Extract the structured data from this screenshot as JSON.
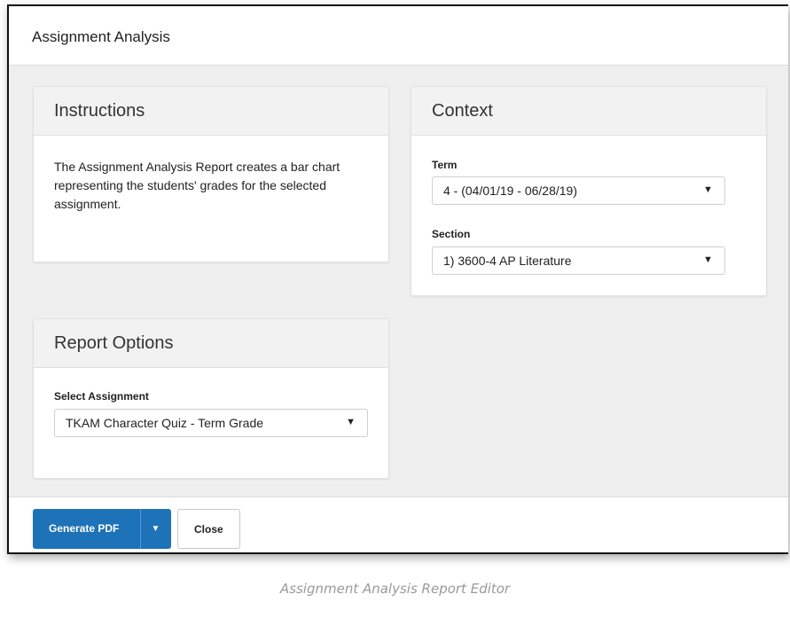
{
  "window": {
    "title": "Assignment Analysis"
  },
  "instructions": {
    "heading": "Instructions",
    "text": "The Assignment Analysis Report creates a bar chart representing the students' grades for the selected assignment."
  },
  "context": {
    "heading": "Context",
    "term": {
      "label": "Term",
      "value": "4 - (04/01/19 - 06/28/19)"
    },
    "section": {
      "label": "Section",
      "value": "1) 3600-4 AP Literature"
    }
  },
  "report_options": {
    "heading": "Report Options",
    "assignment": {
      "label": "Select Assignment",
      "value": "TKAM Character Quiz - Term Grade"
    }
  },
  "footer": {
    "generate_label": "Generate PDF",
    "close_label": "Close"
  },
  "icons": {
    "dropdown_arrow": "caret-down-icon"
  },
  "colors": {
    "primary_button": "#1e72b8",
    "panel_background": "#efefef"
  },
  "caption": "Assignment Analysis Report Editor"
}
